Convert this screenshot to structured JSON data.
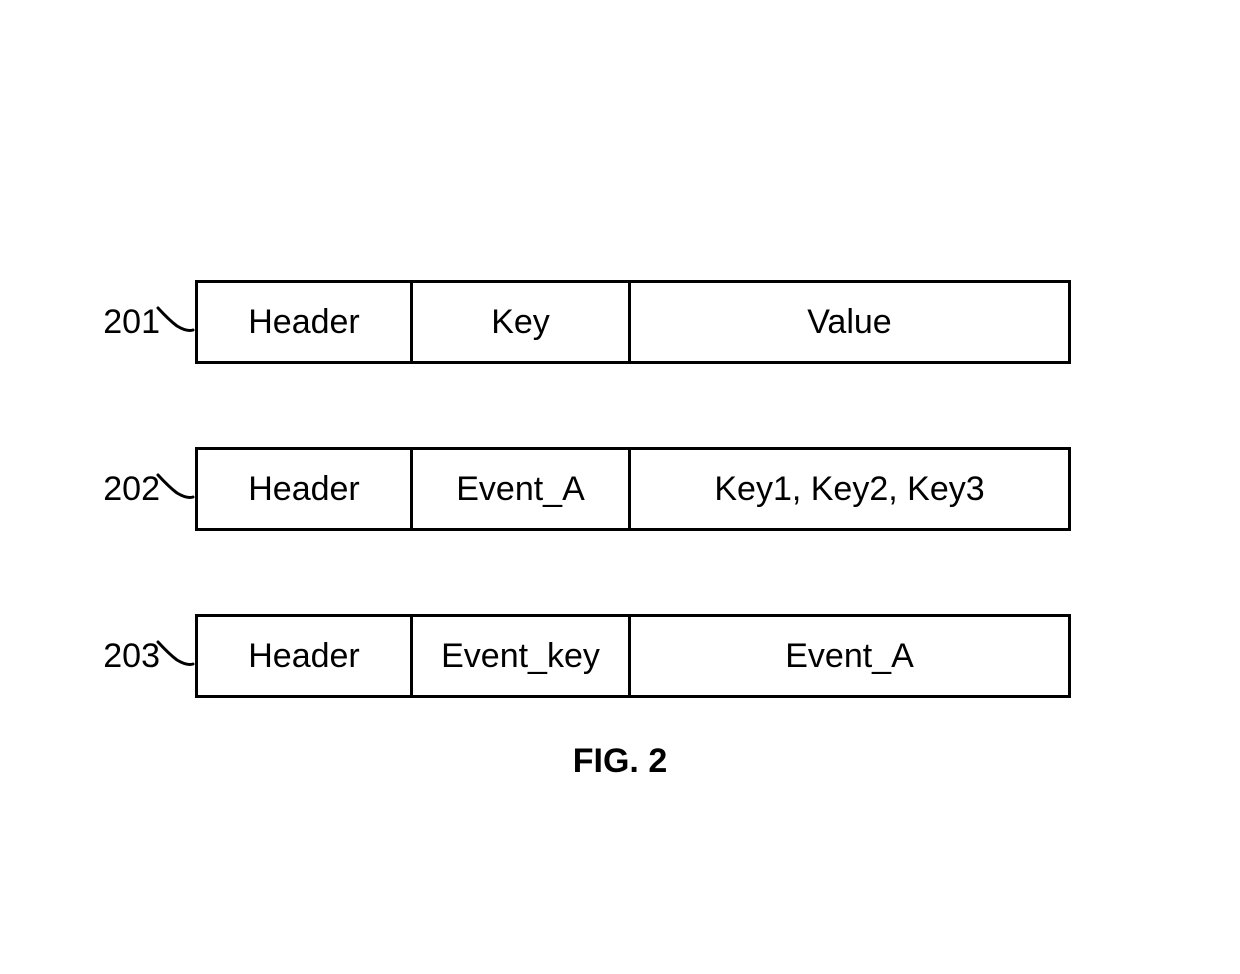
{
  "rows": [
    {
      "label": "201",
      "col1": "Header",
      "col2": "Key",
      "col3": "Value"
    },
    {
      "label": "202",
      "col1": "Header",
      "col2": "Event_A",
      "col3": "Key1, Key2, Key3"
    },
    {
      "label": "203",
      "col1": "Header",
      "col2": "Event_key",
      "col3": "Event_A"
    }
  ],
  "caption": "FIG. 2"
}
